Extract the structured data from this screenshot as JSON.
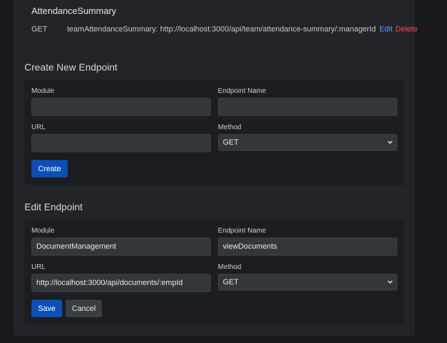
{
  "existing": {
    "module_name": "AttendanceSummary",
    "endpoints": [
      {
        "method": "GET",
        "text": "teamAttendanceSummary: http://localhost:3000/api/team/attendance-summary/:managerId",
        "edit_label": "Edit",
        "delete_label": "Delete"
      }
    ]
  },
  "create": {
    "title": "Create New Endpoint",
    "module_label": "Module",
    "module_value": "",
    "name_label": "Endpoint Name",
    "name_value": "",
    "url_label": "URL",
    "url_value": "",
    "method_label": "Method",
    "method_value": "GET",
    "submit_label": "Create"
  },
  "edit": {
    "title": "Edit Endpoint",
    "module_label": "Module",
    "module_value": "DocumentManagement",
    "name_label": "Endpoint Name",
    "name_value": "viewDocuments",
    "url_label": "URL",
    "url_value": "http://localhost:3000/api/documents/:empId",
    "method_label": "Method",
    "method_value": "GET",
    "save_label": "Save",
    "cancel_label": "Cancel"
  },
  "colors": {
    "primary_button": "#0b4fb7",
    "edit_link": "#5a9bff",
    "delete_link": "#ff4b57"
  },
  "icons": {
    "select_chevron": "chevron-down-icon"
  }
}
